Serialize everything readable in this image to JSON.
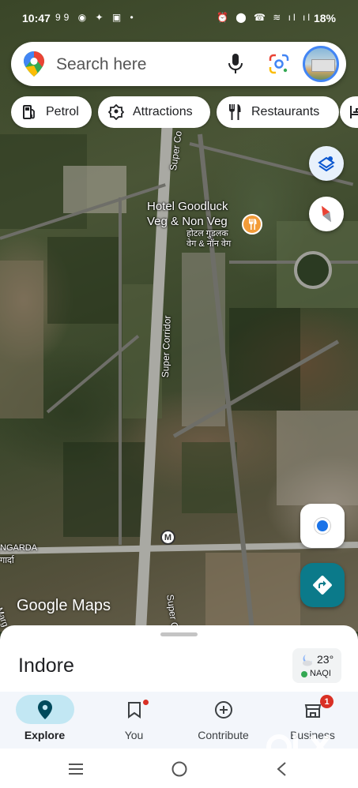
{
  "status_bar": {
    "time": "10:47",
    "left_icons": "99 ◉ ✦ ▣ •",
    "right_icons": "⏰ ⬤ ☎ ≋ ıl ıl",
    "battery": "18%"
  },
  "search": {
    "placeholder": "Search here"
  },
  "chips": [
    {
      "label": "Petrol",
      "icon": "fuel-icon"
    },
    {
      "label": "Attractions",
      "icon": "attractions-icon"
    },
    {
      "label": "Restaurants",
      "icon": "restaurant-icon"
    }
  ],
  "map": {
    "poi_name_line1": "Hotel Goodluck",
    "poi_name_line2": "Veg & Non Veg",
    "poi_name_hi_line1": "होटल गुडलक",
    "poi_name_hi_line2": "वेग & नॉन वेग",
    "road_label_top": "Super Co",
    "road_label_mid": "Super Corridor",
    "road_label_bottom": "Super C",
    "area_label_1": "NGARDA",
    "area_label_2": "गार्दा",
    "area_label_3": "Marg",
    "motorway_symbol": "M",
    "logo": "Google Maps"
  },
  "sheet": {
    "city": "Indore",
    "weather_temp": "23°",
    "aqi_label": "NAQI"
  },
  "bottom_nav": [
    {
      "label": "Explore",
      "icon": "explore-pin-icon",
      "active": true
    },
    {
      "label": "You",
      "icon": "bookmark-icon"
    },
    {
      "label": "Contribute",
      "icon": "add-circle-icon"
    },
    {
      "label": "Business",
      "icon": "business-icon",
      "badge": "1"
    }
  ],
  "watermark": "OLX"
}
